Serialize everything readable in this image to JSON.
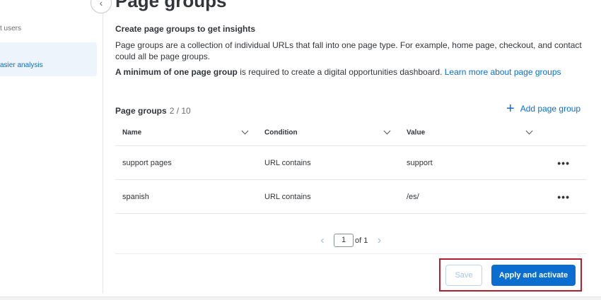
{
  "sidebar": {
    "item_partial": "t users",
    "active_partial": "asier analysis"
  },
  "title": "Page groups",
  "intro": {
    "heading": "Create page groups to get insights",
    "description": "Page groups are a collection of individual URLs that fall into one page type. For example, home page, checkout, and contact could all be page groups.",
    "requirement_bold": "A minimum of one page group",
    "requirement_rest": " is required to create a digital opportunities dashboard. ",
    "learn_more": "Learn more about page groups"
  },
  "page_groups": {
    "label": "Page groups",
    "count": "2 / 10",
    "add_label": "Add page group",
    "columns": [
      "Name",
      "Condition",
      "Value"
    ],
    "rows": [
      {
        "name": "support pages",
        "condition": "URL contains",
        "value": "support"
      },
      {
        "name": "spanish",
        "condition": "URL contains",
        "value": "/es/"
      }
    ]
  },
  "pagination": {
    "page": "1",
    "of": "of 1"
  },
  "buttons": {
    "save": "Save",
    "apply": "Apply and activate"
  }
}
